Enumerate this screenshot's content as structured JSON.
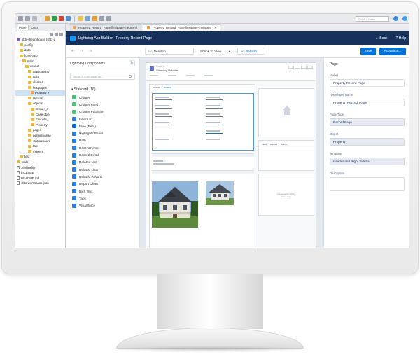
{
  "eclipse": {
    "quick_access": "Quick Access",
    "explorer_tabs": [
      "Proje",
      "OS S"
    ],
    "tree": [
      {
        "label": "sfdx-dreamhouse [sfdx-d",
        "indent": 0,
        "icon": "project"
      },
      {
        "label": "config",
        "indent": 1,
        "icon": "folder"
      },
      {
        "label": "data",
        "indent": 1,
        "icon": "folder"
      },
      {
        "label": "force-app",
        "indent": 1,
        "icon": "folder"
      },
      {
        "label": "main",
        "indent": 2,
        "icon": "folder"
      },
      {
        "label": "default",
        "indent": 3,
        "icon": "folder"
      },
      {
        "label": "applications",
        "indent": 4,
        "icon": "folder"
      },
      {
        "label": "aura",
        "indent": 4,
        "icon": "folder"
      },
      {
        "label": "classes",
        "indent": 4,
        "icon": "folder"
      },
      {
        "label": "flexipages",
        "indent": 4,
        "icon": "folder"
      },
      {
        "label": "Property_I",
        "indent": 5,
        "icon": "xml",
        "selected": true
      },
      {
        "label": "layouts",
        "indent": 4,
        "icon": "folder"
      },
      {
        "label": "objects",
        "indent": 4,
        "icon": "folder"
      },
      {
        "label": "Broker_c",
        "indent": 5,
        "icon": "folder"
      },
      {
        "label": "Case.obje",
        "indent": 5,
        "icon": "folder"
      },
      {
        "label": "Favorite_",
        "indent": 5,
        "icon": "folder"
      },
      {
        "label": "Property",
        "indent": 5,
        "icon": "folder"
      },
      {
        "label": "pages",
        "indent": 4,
        "icon": "folder"
      },
      {
        "label": "permissionse",
        "indent": 4,
        "icon": "folder"
      },
      {
        "label": "staticresourc",
        "indent": 4,
        "icon": "folder"
      },
      {
        "label": "tabs",
        "indent": 4,
        "icon": "folder"
      },
      {
        "label": "triggers",
        "indent": 4,
        "icon": "folder"
      },
      {
        "label": "test",
        "indent": 1,
        "icon": "folder"
      },
      {
        "label": "tools",
        "indent": 0,
        "icon": "folder"
      },
      {
        "label": "Jenkinsfile",
        "indent": 0,
        "icon": "file"
      },
      {
        "label": "LICENSE",
        "indent": 0,
        "icon": "file"
      },
      {
        "label": "README.md",
        "indent": 0,
        "icon": "file"
      },
      {
        "label": "sfdx-workspace.json",
        "indent": 0,
        "icon": "file"
      }
    ]
  },
  "editor_tabs": [
    {
      "label": "Property_Record_Page.flexipage-meta.xml",
      "active": false
    },
    {
      "label": "Property_Record_Page.flexipage-meta.xml",
      "active": true
    }
  ],
  "builder": {
    "title": "Lightning App Builder - Property Record Page",
    "back_label": "Back",
    "help_label": "Help",
    "device": "Desktop",
    "zoom": "Shrink To View",
    "refresh_label": "Refresh",
    "save_label": "Save",
    "activation_label": "Activation..."
  },
  "components": {
    "header": "Lightning Components",
    "search_placeholder": "Search components...",
    "section": "Standard (16)",
    "items": [
      "Chatter",
      "Chatter Feed",
      "Chatter Publisher",
      "Filter List",
      "Flow (Beta)",
      "Highlights Panel",
      "Path",
      "Recent Items",
      "Record Detail",
      "Related List",
      "Related Lists",
      "Related Record",
      "Report Chart",
      "Rich Text",
      "Tabs",
      "Visualforce"
    ],
    "icon_colors": [
      "#4bc076",
      "#4bc076",
      "#4bc076",
      "#2e7fd8",
      "#0070d2",
      "#2e7fd8",
      "#2e7fd8",
      "#2e7fd8",
      "#2e7fd8",
      "#2e7fd8",
      "#2e7fd8",
      "#2e7fd8",
      "#2e7fd8",
      "#2e7fd8",
      "#2e7fd8",
      "#2e7fd8"
    ]
  },
  "canvas": {
    "record_title": "Stunning Victorian",
    "record_type": "Property",
    "main_tabs": [
      "Details",
      "Related"
    ],
    "side_tabs": [
      "Feed",
      "Related",
      "Activity"
    ],
    "empty_placeholder_line1": "Components can be",
    "empty_placeholder_line2": "added here."
  },
  "properties": {
    "panel_title": "Page",
    "label_label": "Label",
    "label_value": "Property Record Page",
    "devname_label": "Developer Name",
    "devname_value": "Property_Record_Page",
    "pagetype_label": "Page Type",
    "pagetype_value": "Record Page",
    "object_label": "Object",
    "object_value": "Property",
    "template_label": "Template",
    "template_value": "Header and Right Sidebar",
    "description_label": "Description"
  },
  "colors": {
    "builder_header": "#16325c",
    "brand_blue": "#0070d2",
    "selection": "#4a9ce8"
  }
}
